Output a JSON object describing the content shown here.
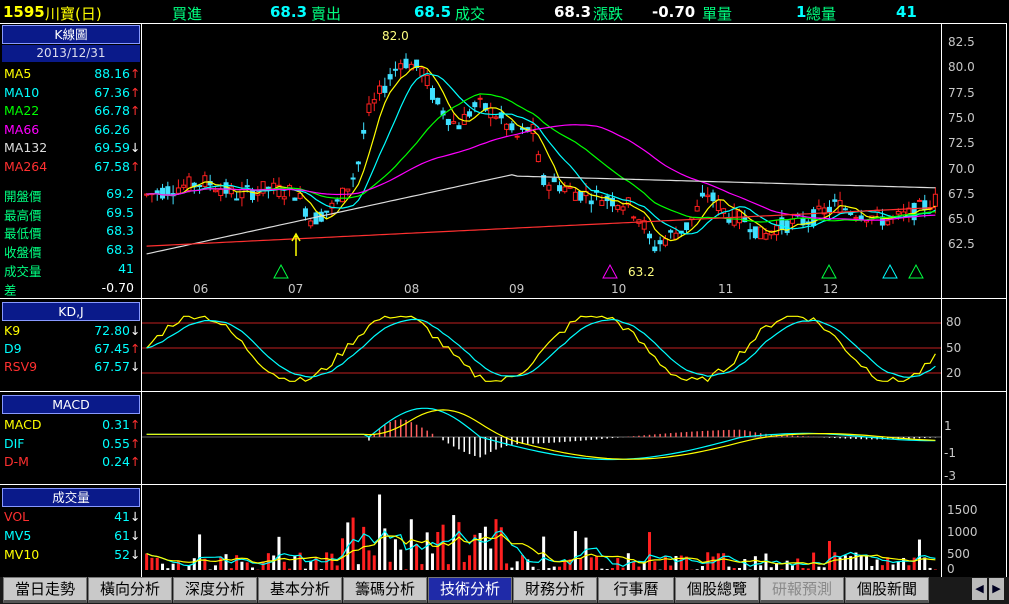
{
  "header": {
    "code": "1595",
    "name": "川寶(日)",
    "buy_label": "買進",
    "buy_value": "68.3",
    "sell_label": "賣出",
    "sell_value": "68.5",
    "deal_label": "成交",
    "deal_value": "68.3",
    "change_label": "漲跌",
    "change_value": "-0.70",
    "vol_label": "單量",
    "vol_value": "1",
    "total_label": "總量",
    "total_value": "41"
  },
  "kline": {
    "title": "K線圖",
    "date": "2013/12/31",
    "ma": [
      {
        "label": "MA5",
        "value": "88.16",
        "arrow": "↑",
        "color": "#ffff00"
      },
      {
        "label": "MA10",
        "value": "67.36",
        "arrow": "↑",
        "color": "#00ffff"
      },
      {
        "label": "MA22",
        "value": "66.78",
        "arrow": "↑",
        "color": "#00ff00"
      },
      {
        "label": "MA66",
        "value": "66.26",
        "arrow": "",
        "color": "#ff00ff"
      },
      {
        "label": "MA132",
        "value": "69.59",
        "arrow": "↓",
        "color": "#dddddd"
      },
      {
        "label": "MA264",
        "value": "67.58",
        "arrow": "↑",
        "color": "#ff3030"
      }
    ],
    "prices": [
      {
        "label": "開盤價",
        "value": "69.2"
      },
      {
        "label": "最高價",
        "value": "69.5"
      },
      {
        "label": "最低價",
        "value": "68.3"
      },
      {
        "label": "收盤價",
        "value": "68.3"
      },
      {
        "label": "成交量",
        "value": "41"
      },
      {
        "label": "差",
        "value": "-0.70"
      }
    ],
    "y_ticks": [
      "82.5",
      "80.0",
      "77.5",
      "75.0",
      "72.5",
      "70.0",
      "67.5",
      "65.0",
      "62.5"
    ],
    "x_ticks": [
      "06",
      "07",
      "08",
      "09",
      "10",
      "11",
      "12"
    ],
    "high_label": "82.0",
    "low_label": "63.2"
  },
  "kdj": {
    "title": "KD,J",
    "rows": [
      {
        "label": "K9",
        "value": "72.80",
        "arrow": "↓",
        "color": "#ffff00"
      },
      {
        "label": "D9",
        "value": "67.45",
        "arrow": "↑",
        "color": "#00ffff"
      },
      {
        "label": "RSV9",
        "value": "67.57",
        "arrow": "↓",
        "color": "#ff3030"
      }
    ],
    "y_ticks": [
      "80",
      "50",
      "20"
    ]
  },
  "macd": {
    "title": "MACD",
    "rows": [
      {
        "label": "MACD",
        "value": "0.31",
        "arrow": "↑",
        "color": "#ffff00"
      },
      {
        "label": "DIF",
        "value": "0.55",
        "arrow": "↑",
        "color": "#00ffff"
      },
      {
        "label": "D-M",
        "value": "0.24",
        "arrow": "↑",
        "color": "#ff3030"
      }
    ],
    "y_ticks": [
      "1",
      "-1",
      "-3"
    ]
  },
  "volume": {
    "title": "成交量",
    "rows": [
      {
        "label": "VOL",
        "value": "41",
        "arrow": "↓",
        "color": "#ff3030"
      },
      {
        "label": "MV5",
        "value": "61",
        "arrow": "↓",
        "color": "#00ffff"
      },
      {
        "label": "MV10",
        "value": "52",
        "arrow": "↓",
        "color": "#ffff00"
      }
    ],
    "y_ticks": [
      "1500",
      "1000",
      "500",
      "0"
    ]
  },
  "tabs": [
    "當日走勢",
    "橫向分析",
    "深度分析",
    "基本分析",
    "籌碼分析",
    "技術分析",
    "財務分析",
    "行事曆",
    "個股總覽",
    "研報預測",
    "個股新聞"
  ],
  "active_tab": 5
}
